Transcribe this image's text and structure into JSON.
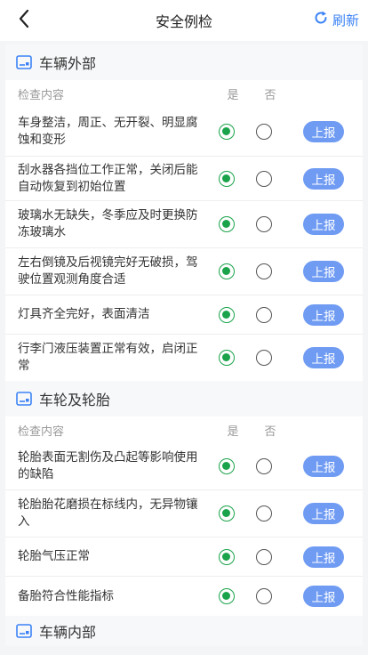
{
  "header": {
    "title": "安全例检",
    "refresh_label": "刷新"
  },
  "colors": {
    "accent": "#3b82f6",
    "report_button": "#6f9bf3",
    "radio_checked": "#1aa34a"
  },
  "sections": [
    {
      "title": "车辆外部",
      "columns": {
        "content": "检查内容",
        "yes": "是",
        "no": "否"
      },
      "items": [
        {
          "text": "车身整洁，周正、无开裂、明显腐蚀和变形",
          "selected": "yes",
          "report": "上报"
        },
        {
          "text": "刮水器各挡位工作正常，关闭后能自动恢复到初始位置",
          "selected": "yes",
          "report": "上报"
        },
        {
          "text": "玻璃水无缺失，冬季应及时更换防冻玻璃水",
          "selected": "yes",
          "report": "上报"
        },
        {
          "text": "左右倒镜及后视镜完好无破损，驾驶位置观测角度合适",
          "selected": "yes",
          "report": "上报"
        },
        {
          "text": "灯具齐全完好，表面清洁",
          "selected": "yes",
          "report": "上报"
        },
        {
          "text": "行李门液压装置正常有效，启闭正常",
          "selected": "yes",
          "report": "上报"
        }
      ]
    },
    {
      "title": "车轮及轮胎",
      "columns": {
        "content": "检查内容",
        "yes": "是",
        "no": "否"
      },
      "items": [
        {
          "text": "轮胎表面无割伤及凸起等影响使用的缺陷",
          "selected": "yes",
          "report": "上报"
        },
        {
          "text": "轮胎胎花磨损在标线内，无异物镶入",
          "selected": "yes",
          "report": "上报"
        },
        {
          "text": "轮胎气压正常",
          "selected": "yes",
          "report": "上报"
        },
        {
          "text": "备胎符合性能指标",
          "selected": "yes",
          "report": "上报"
        }
      ]
    },
    {
      "title": "车辆内部"
    }
  ]
}
